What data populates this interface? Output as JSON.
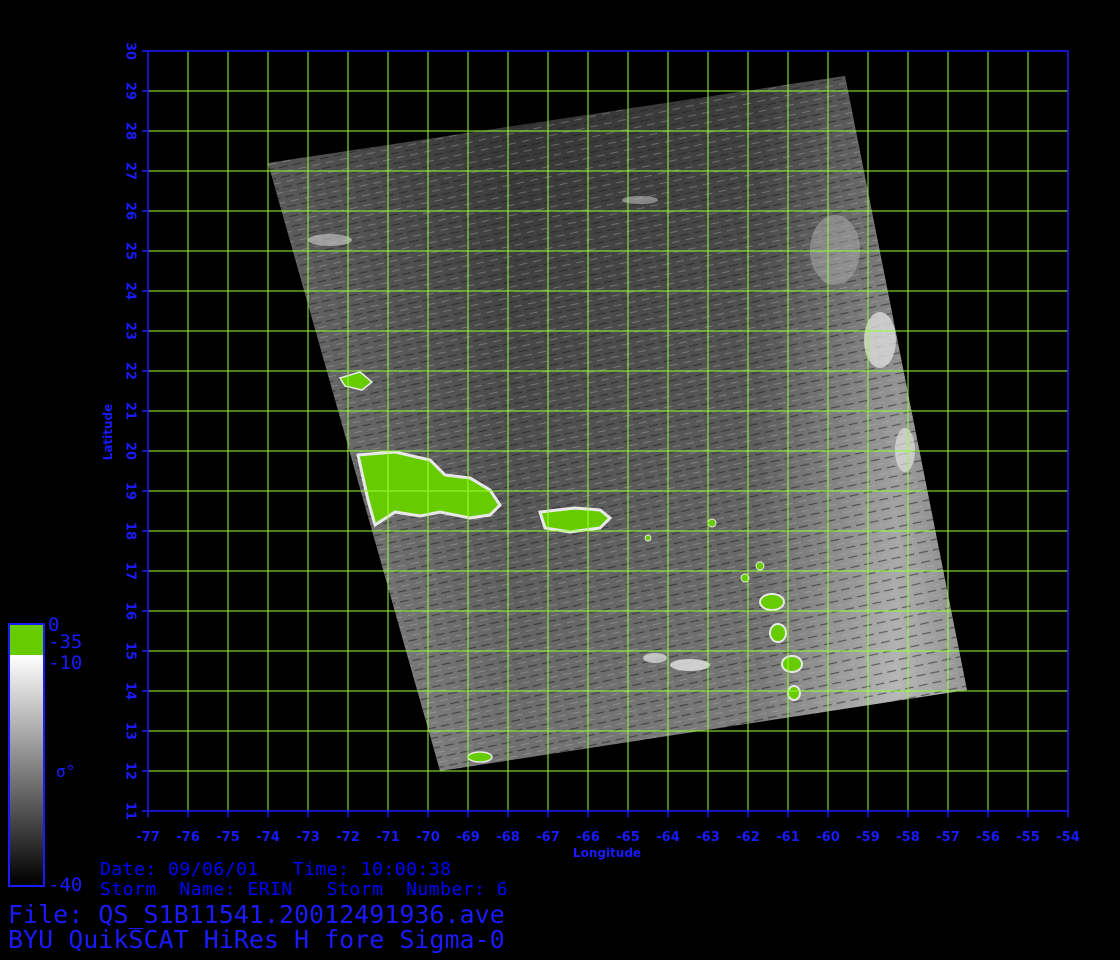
{
  "map": {
    "longitude_label": "Longitude",
    "latitude_label": "Latitude",
    "lon_ticks": [
      "-77",
      "-76",
      "-75",
      "-74",
      "-73",
      "-72",
      "-71",
      "-70",
      "-69",
      "-68",
      "-67",
      "-66",
      "-65",
      "-64",
      "-63",
      "-62",
      "-61",
      "-60",
      "-59",
      "-58",
      "-57",
      "-56",
      "-55",
      "-54"
    ],
    "lat_ticks": [
      "11",
      "12",
      "13",
      "14",
      "15",
      "16",
      "17",
      "18",
      "19",
      "20",
      "21",
      "22",
      "23",
      "24",
      "25",
      "26",
      "27",
      "28",
      "29",
      "30"
    ],
    "lon_range": [
      -77,
      -54
    ],
    "lat_range": [
      11,
      30
    ],
    "grid_color": "#99ff33",
    "axis_color": "#1a1aff",
    "land_color": "#66cc00"
  },
  "colorbar": {
    "top_label": "0",
    "land_label": "-35",
    "upper_label": "-10",
    "bottom_label": "-40",
    "symbol": "σ°"
  },
  "info": {
    "date_line": "Date: 09/06/01   Time: 10:00:38",
    "storm_line": "Storm  Name: ERIN   Storm  Number: 6",
    "file_line": "File: QS_S1B11541.20012491936.ave",
    "product_line": "BYU QuikSCAT HiRes H fore Sigma-0"
  }
}
